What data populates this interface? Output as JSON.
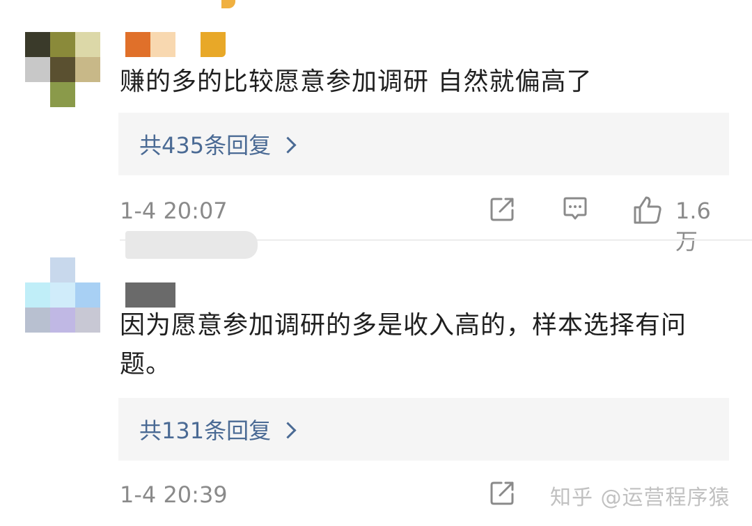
{
  "comments": [
    {
      "text": "赚的多的比较愿意参加调研 自然就偏高了",
      "reply_label": "共435条回复",
      "timestamp": "1-4 20:07",
      "like_count": "1.6万"
    },
    {
      "text": "因为愿意参加调研的多是收入高的，样本选择有问题。",
      "reply_label": "共131条回复",
      "timestamp": "1-4 20:39"
    }
  ],
  "watermark": "知乎 @运营程序猿",
  "colors": {
    "reply_link": "#4a6a94",
    "meta_gray": "#8a8a8a",
    "reply_bg": "#f5f5f5"
  },
  "icons": [
    "share-icon",
    "comment-icon",
    "like-icon",
    "chevron-right-icon"
  ]
}
